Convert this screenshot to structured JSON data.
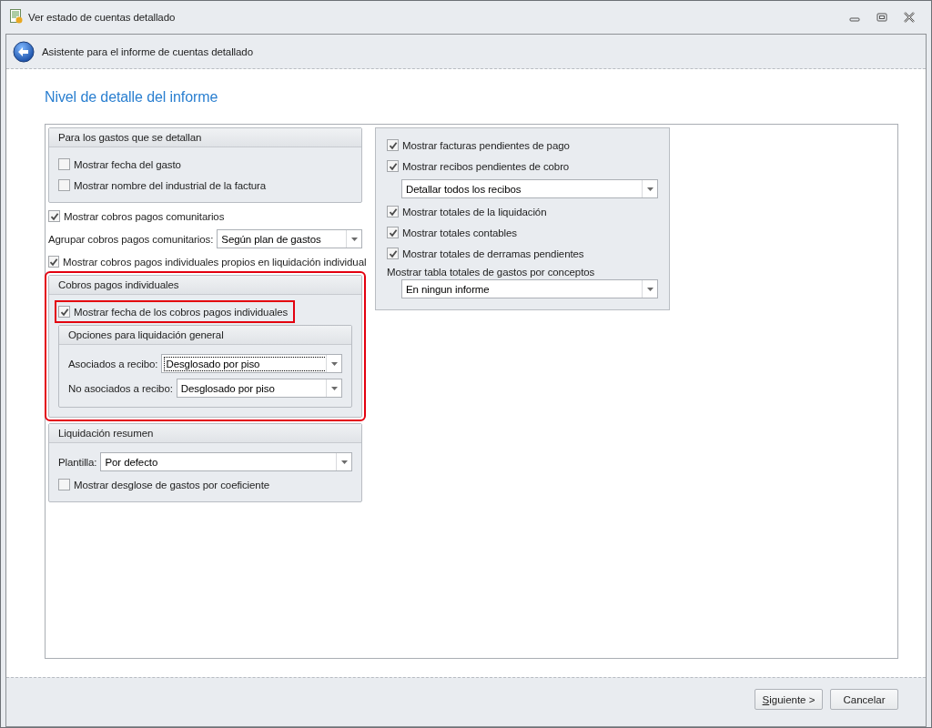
{
  "window": {
    "title": "Ver estado de cuentas detallado"
  },
  "header": {
    "title": "Asistente para el informe de cuentas detallado"
  },
  "page_heading": "Nivel de detalle del informe",
  "left_column": [
    {
      "kind": "group",
      "title": "Para los gastos que se detallan",
      "items": [
        {
          "kind": "checkbox",
          "label": "Mostrar fecha del gasto",
          "checked": false
        },
        {
          "kind": "checkbox",
          "label": "Mostrar nombre del industrial de la factura",
          "checked": false
        }
      ]
    },
    {
      "kind": "checkbox",
      "label": "Mostrar cobros pagos comunitarios",
      "checked": true
    },
    {
      "kind": "combo",
      "label": "Agrupar cobros pagos comunitarios:",
      "value": "Según plan de gastos"
    },
    {
      "kind": "checkbox",
      "label": "Mostrar cobros pagos individuales propios en liquidación individual",
      "checked": true
    },
    {
      "kind": "group",
      "title": "Cobros pagos individuales",
      "highlighted": true,
      "items": [
        {
          "kind": "checkbox",
          "label": "Mostrar fecha de los cobros pagos individuales",
          "checked": true,
          "highlighted": true
        },
        {
          "kind": "group",
          "title": "Opciones para liquidación general",
          "items": [
            {
              "kind": "combo",
              "label": "Asociados a recibo:",
              "value": "Desglosado por piso",
              "focused": true
            },
            {
              "kind": "combo",
              "label": "No asociados a recibo:",
              "value": "Desglosado por piso"
            }
          ]
        }
      ]
    },
    {
      "kind": "group",
      "title": "Liquidación resumen",
      "items": [
        {
          "kind": "combo",
          "label": "Plantilla:",
          "value": "Por defecto"
        },
        {
          "kind": "checkbox",
          "label": "Mostrar desglose de gastos por coeficiente",
          "checked": false
        }
      ]
    }
  ],
  "right_panel": [
    {
      "kind": "checkbox",
      "label": "Mostrar facturas pendientes de pago",
      "checked": true
    },
    {
      "kind": "checkbox",
      "label": "Mostrar recibos pendientes de cobro",
      "checked": true
    },
    {
      "kind": "combo",
      "value": "Detallar todos los recibos"
    },
    {
      "kind": "checkbox",
      "label": "Mostrar totales de la liquidación",
      "checked": true
    },
    {
      "kind": "checkbox",
      "label": "Mostrar totales contables",
      "checked": true
    },
    {
      "kind": "checkbox",
      "label": "Mostrar totales de derramas pendientes",
      "checked": true
    },
    {
      "kind": "caption",
      "label": "Mostrar tabla totales de gastos por conceptos"
    },
    {
      "kind": "combo",
      "value": "En ningun informe"
    }
  ],
  "buttons": [
    {
      "label": "Siguiente >",
      "kind": "primary"
    },
    {
      "label": "Cancelar",
      "kind": "cancel"
    }
  ]
}
